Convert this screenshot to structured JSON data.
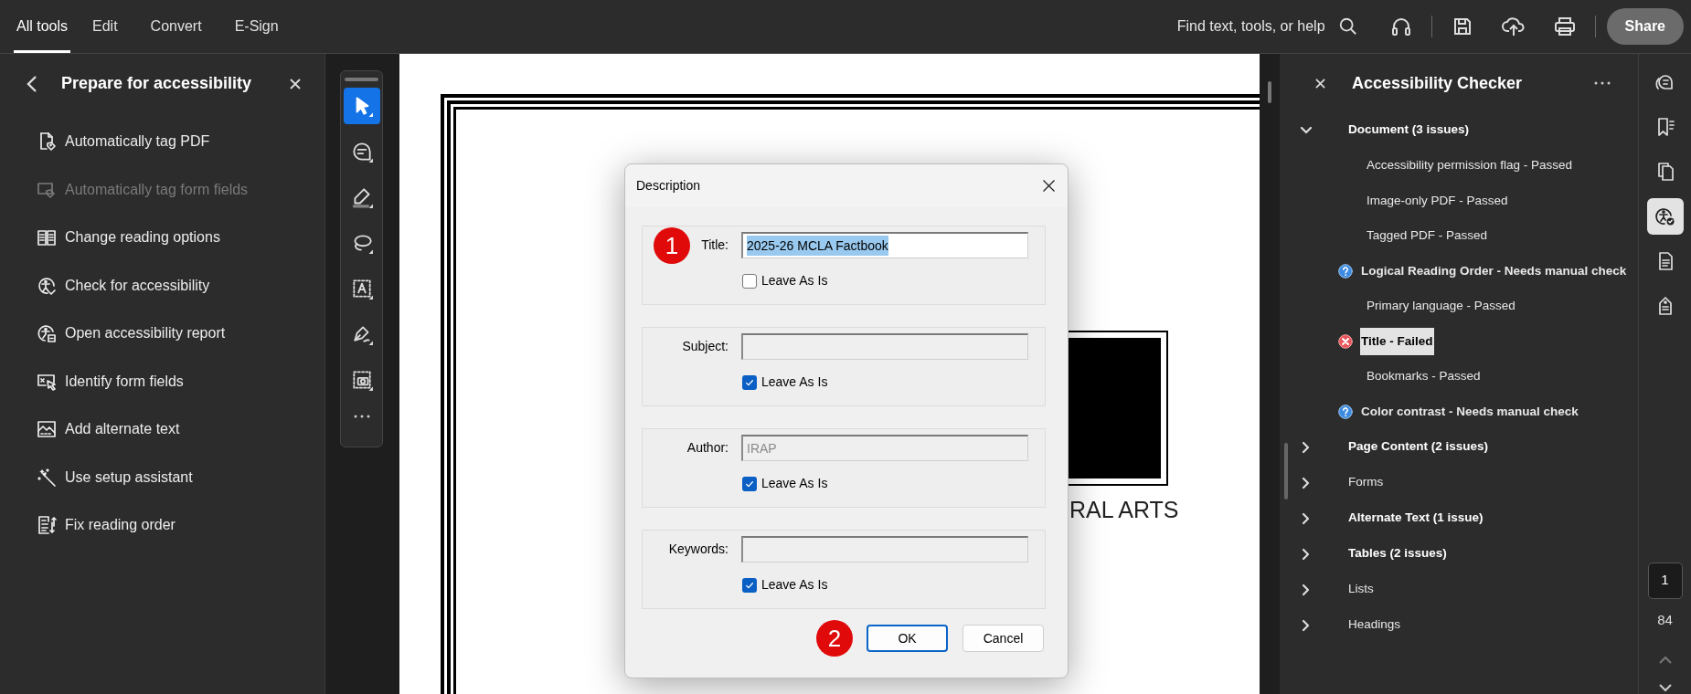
{
  "top_bar": {
    "tabs": [
      {
        "label": "All tools",
        "selected": true
      },
      {
        "label": "Edit",
        "selected": false
      },
      {
        "label": "Convert",
        "selected": false
      },
      {
        "label": "E-Sign",
        "selected": false
      }
    ],
    "search_placeholder": "Find text, tools, or help",
    "share_button": "Share"
  },
  "left_panel": {
    "title": "Prepare for accessibility",
    "items": [
      {
        "label": "Automatically tag PDF",
        "disabled": false
      },
      {
        "label": "Automatically tag form fields",
        "disabled": true
      },
      {
        "label": "Change reading options",
        "disabled": false
      },
      {
        "label": "Check for accessibility",
        "disabled": false
      },
      {
        "label": "Open accessibility report",
        "disabled": false
      },
      {
        "label": "Identify form fields",
        "disabled": false
      },
      {
        "label": "Add alternate text",
        "disabled": false
      },
      {
        "label": "Use setup assistant",
        "disabled": false
      },
      {
        "label": "Fix reading order",
        "disabled": false
      }
    ]
  },
  "toolbar": {
    "tools": [
      {
        "selected": true
      },
      {
        "selected": false
      },
      {
        "selected": false
      },
      {
        "selected": false
      },
      {
        "selected": false
      },
      {
        "selected": false
      },
      {
        "selected": false
      }
    ]
  },
  "document": {
    "logo_caption": "RAL ARTS"
  },
  "dialog": {
    "title": "Description",
    "fields": [
      {
        "label": "Title:",
        "value": "2025-26 MCLA Factbook",
        "value_selected": true,
        "disabled": false,
        "callout": "1",
        "checkbox": {
          "label": "Leave As Is",
          "checked": false
        }
      },
      {
        "label": "Subject:",
        "disabled": true,
        "checkbox": {
          "label": "Leave As Is",
          "checked": true
        }
      },
      {
        "label": "Author:",
        "value": "IRAP",
        "value_selected": false,
        "disabled": true,
        "checkbox": {
          "label": "Leave As Is",
          "checked": true
        }
      },
      {
        "label": "Keywords:",
        "disabled": true,
        "checkbox": {
          "label": "Leave As Is",
          "checked": true
        }
      }
    ],
    "buttons_callout": "2",
    "buttons": [
      {
        "label": "OK",
        "default": true
      },
      {
        "label": "Cancel",
        "default": false
      }
    ]
  },
  "accessibility_checker": {
    "title": "Accessibility Checker",
    "categories": [
      {
        "label": "Document (3 issues)",
        "has_issues": true,
        "expanded": true,
        "children": [
          {
            "label": "Accessibility permission flag - Passed",
            "kind": "passed",
            "selected": false
          },
          {
            "label": "Image-only PDF - Passed",
            "kind": "passed",
            "selected": false
          },
          {
            "label": "Tagged PDF - Passed",
            "kind": "passed",
            "selected": false
          },
          {
            "label": "Logical Reading Order - Needs manual check",
            "kind": "manual",
            "selected": false
          },
          {
            "label": "Primary language - Passed",
            "kind": "passed",
            "selected": false
          },
          {
            "label": "Title - Failed",
            "kind": "failed",
            "selected": true
          },
          {
            "label": "Bookmarks - Passed",
            "kind": "passed",
            "selected": false
          },
          {
            "label": "Color contrast - Needs manual check",
            "kind": "manual",
            "selected": false
          }
        ]
      },
      {
        "label": "Page Content (2 issues)",
        "has_issues": true,
        "expanded": false
      },
      {
        "label": "Forms",
        "has_issues": false,
        "expanded": false
      },
      {
        "label": "Alternate Text (1 issue)",
        "has_issues": true,
        "expanded": false
      },
      {
        "label": "Tables (2 issues)",
        "has_issues": true,
        "expanded": false
      },
      {
        "label": "Lists",
        "has_issues": false,
        "expanded": false
      },
      {
        "label": "Headings",
        "has_issues": false,
        "expanded": false
      }
    ]
  },
  "side_rail": {
    "tools": [
      {
        "selected": false
      },
      {
        "selected": false
      },
      {
        "selected": false
      },
      {
        "selected": true
      },
      {
        "selected": false
      },
      {
        "selected": false
      }
    ],
    "current_page": "1",
    "page_count": "84"
  }
}
